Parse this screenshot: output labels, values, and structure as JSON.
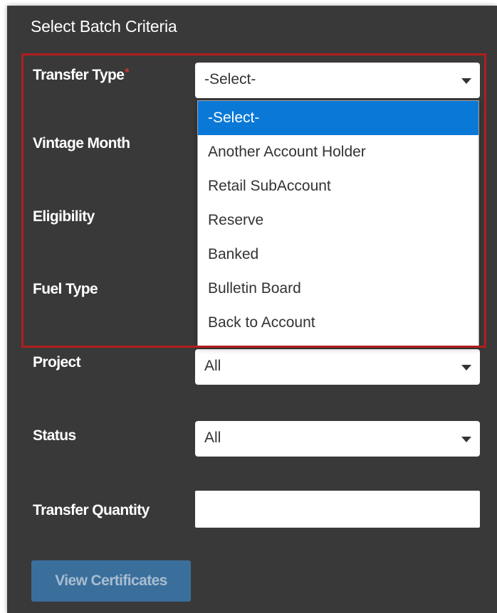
{
  "panel": {
    "title": "Select Batch Criteria"
  },
  "fields": {
    "transfer_type": {
      "label": "Transfer Type",
      "required_marker": "*",
      "value": "-Select-"
    },
    "vintage_month": {
      "label": "Vintage Month"
    },
    "eligibility": {
      "label": "Eligibility"
    },
    "fuel_type": {
      "label": "Fuel Type"
    },
    "project": {
      "label": "Project",
      "value": "All"
    },
    "status": {
      "label": "Status",
      "value": "All"
    },
    "transfer_quantity": {
      "label": "Transfer Quantity",
      "value": ""
    }
  },
  "dropdown": {
    "options": [
      "-Select-",
      "Another Account Holder",
      "Retail SubAccount",
      "Reserve",
      "Banked",
      "Bulletin Board",
      "Back to Account"
    ],
    "selected_index": 0
  },
  "actions": {
    "view_certificates_label": "View Certificates"
  },
  "colors": {
    "panel_background": "#393939",
    "highlight_border": "#b01e1e",
    "required_star": "#e0312c",
    "selected_option": "#0a78d7",
    "button_background": "#3a6f9c",
    "button_text": "#a9bdd0"
  },
  "icons": {
    "select_caret": "caret-down-icon"
  }
}
